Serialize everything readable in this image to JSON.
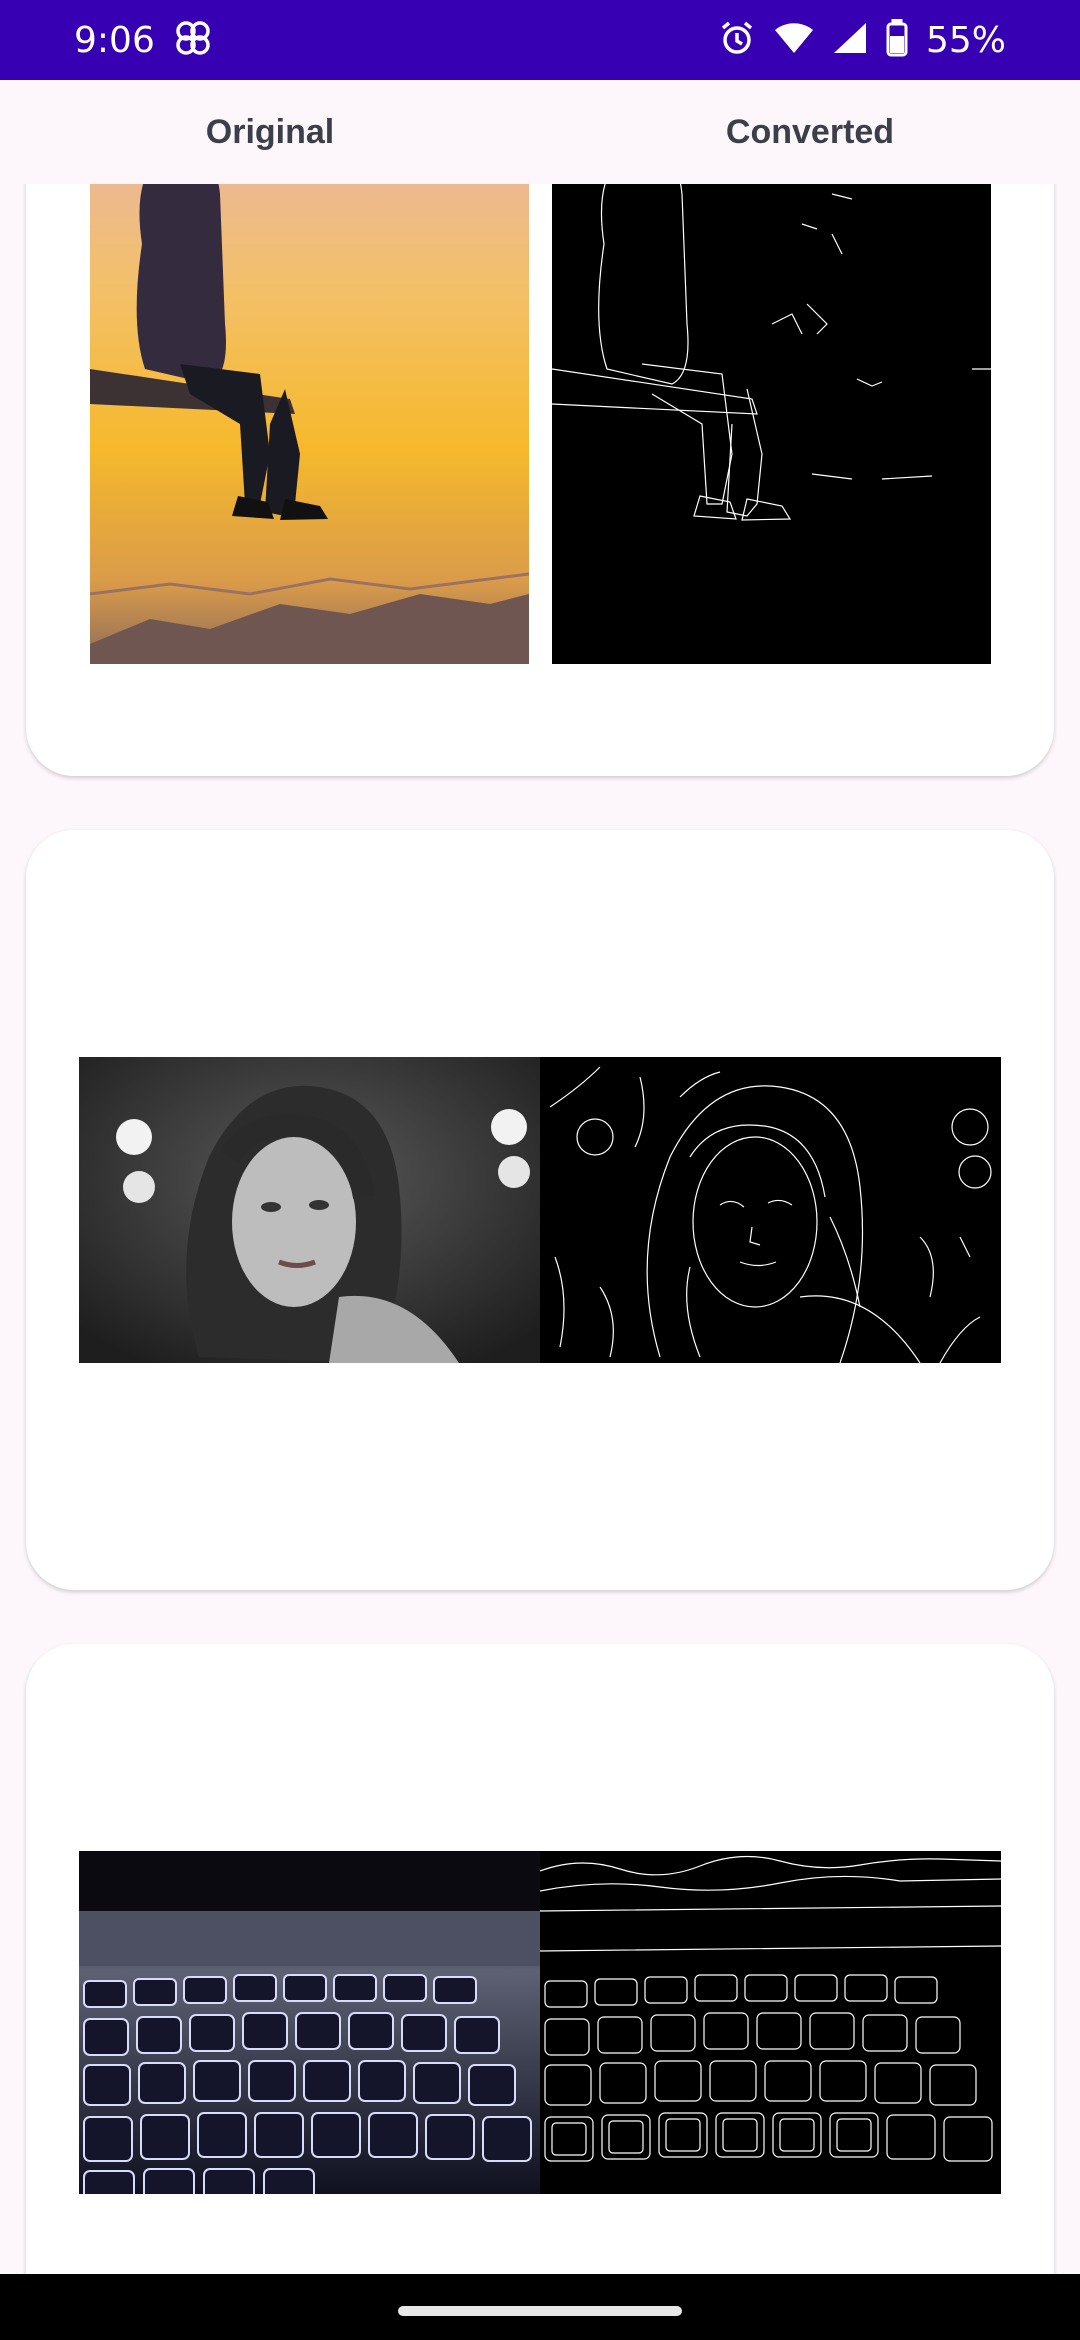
{
  "status_bar": {
    "time": "9:06",
    "battery": "55%",
    "icons": [
      "pinwheel-icon",
      "alarm-icon",
      "wifi-icon",
      "signal-icon",
      "battery-icon"
    ]
  },
  "header": {
    "original_label": "Original",
    "converted_label": "Converted"
  },
  "cards": [
    {
      "original": "person sitting on ledge at sunset",
      "converted": "edge-detected outline of person on ledge"
    },
    {
      "original": "black and white portrait of woman",
      "converted": "edge-detected portrait outline"
    },
    {
      "original": "backlit laptop keyboard",
      "converted": "edge-detected keyboard outline"
    }
  ],
  "colors": {
    "status_bar": "#3700b3",
    "background": "#fdf7fb",
    "card": "#ffffff",
    "header_text": "#3b3f4a"
  }
}
